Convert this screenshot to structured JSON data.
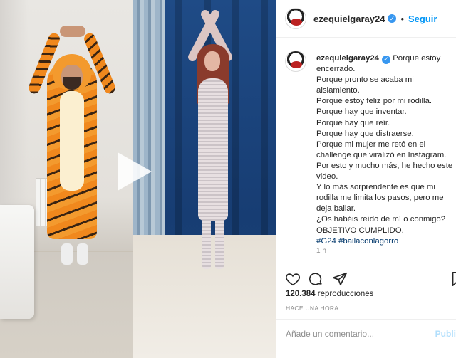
{
  "post": {
    "username": "ezequielgaray24",
    "follow_label": "Seguir",
    "dot": "•",
    "caption_username": "ezequielgaray24",
    "caption_lines": [
      "Porque estoy encerrado.",
      "Porque pronto se acaba mi aislamiento.",
      "Porque estoy feliz por mi rodilla.",
      "Porque hay que inventar.",
      "Porque hay que reír.",
      "Porque hay que distraerse.",
      "Porque mi mujer me retó en el challenge que viralizó en Instagram.",
      "Por esto y mucho más, he hecho este video.",
      "Y lo más sorprendente es que mi rodilla me limita los pasos, pero me deja bailar.",
      "¿Os habéis reído de mí o conmigo?",
      "OBJETIVO CUMPLIDO."
    ],
    "hashtags": "#G24 #bailaconlagorro",
    "caption_time": "1 h",
    "views_count": "120.384",
    "views_label": "reproducciones",
    "posted_ago": "HACE UNA HORA",
    "comment_placeholder": "Añade un comentario...",
    "publish_label": "Publi"
  },
  "icons": [
    "verified-icon",
    "play-icon",
    "heart-icon",
    "comment-icon",
    "share-icon",
    "bookmark-icon"
  ],
  "colors": {
    "link": "#0095f6",
    "verified": "#3897f0",
    "hashtag": "#00376b",
    "muted": "#8e8e8e"
  }
}
